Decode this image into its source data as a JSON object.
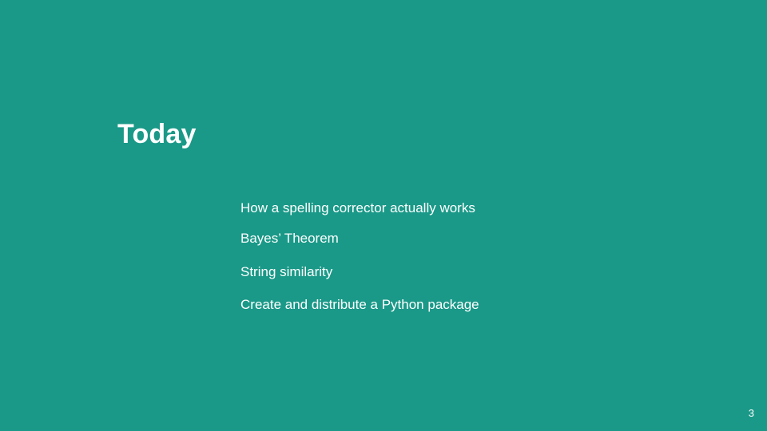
{
  "slide": {
    "background_color": "#1a9988",
    "text_color": "#ffffff",
    "title": "Today",
    "agenda": [
      "How a spelling corrector actually works",
      "Bayes’ Theorem",
      "String similarity",
      "Create and distribute a Python package"
    ],
    "page_number": "3"
  }
}
